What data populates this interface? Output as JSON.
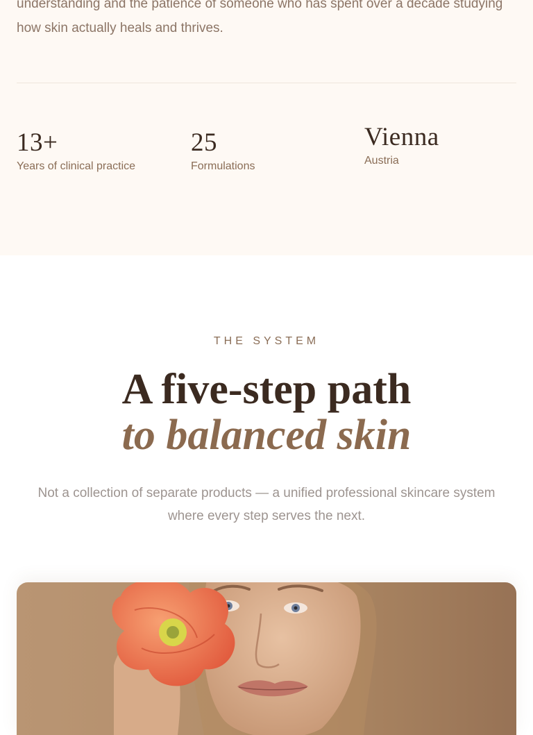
{
  "about": {
    "paragraph": "understanding and the patience of someone who has spent over a decade studying how skin actually heals and thrives."
  },
  "stats": [
    {
      "value": "13+",
      "label": "Years of clinical practice"
    },
    {
      "value": "25",
      "label": "Formulations"
    },
    {
      "value": "Vienna",
      "label": "Austria"
    }
  ],
  "system": {
    "eyebrow": "THE SYSTEM",
    "headline_line1": "A five-step path",
    "headline_line2": "to balanced skin",
    "lede": "Not a collection of separate products — a unified professional skincare system where every step serves the next."
  },
  "hero": {
    "image": "portrait-with-poppy-flower"
  },
  "colors": {
    "background_cream": "#fef9f4",
    "text_dark": "#3b2a20",
    "accent_brown": "#8b6a4f",
    "muted_text": "#9d9490"
  }
}
